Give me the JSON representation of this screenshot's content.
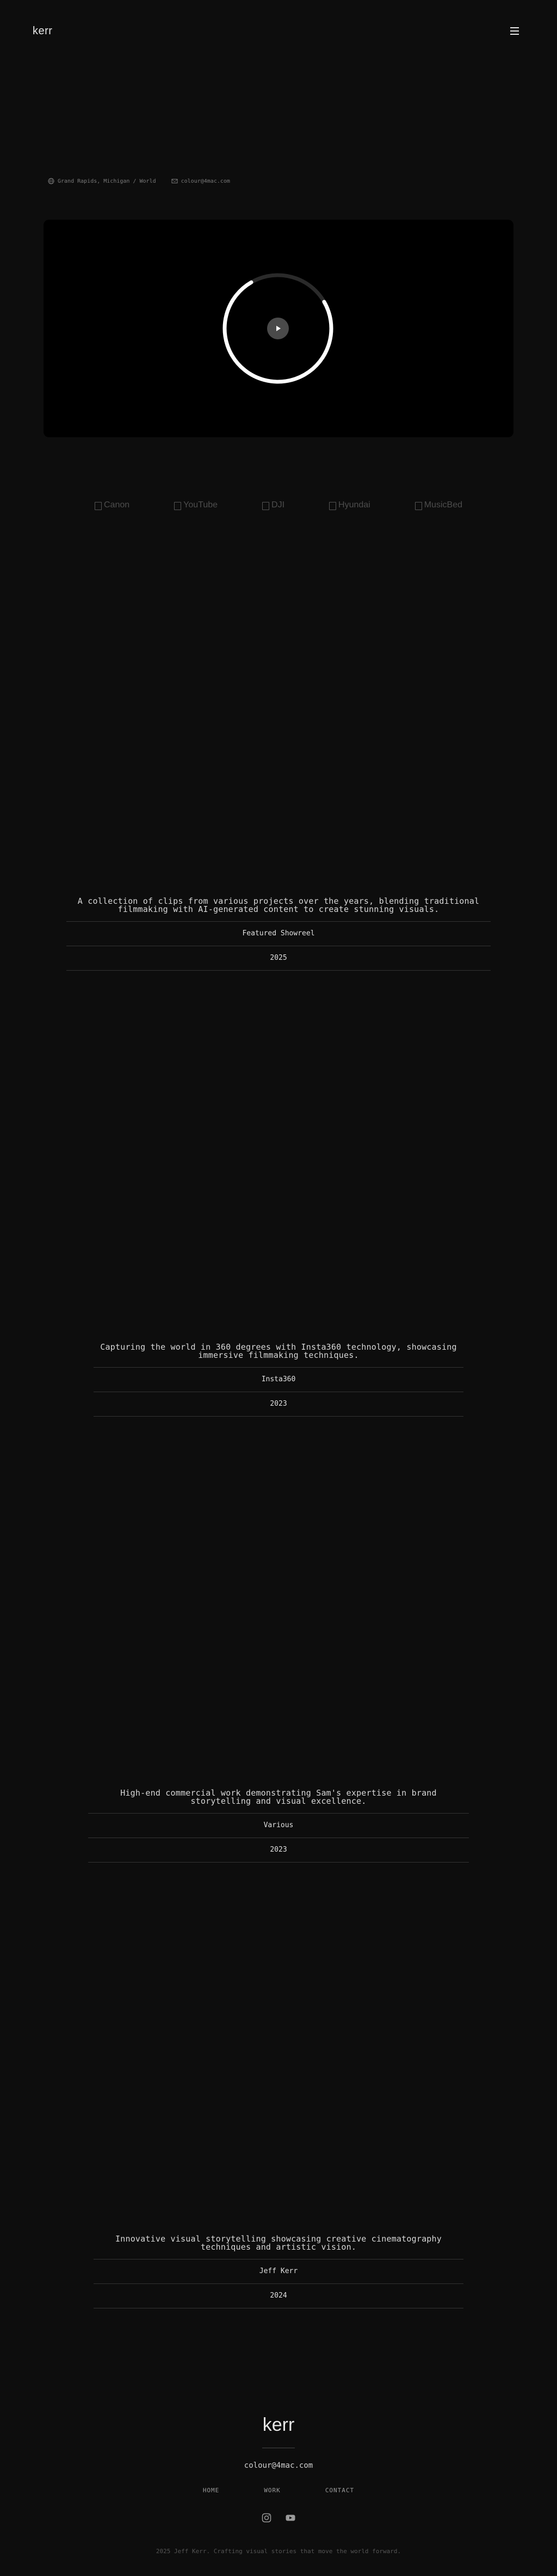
{
  "header": {
    "logo": "kerr",
    "menu_icon": "hamburger-icon"
  },
  "meta": {
    "location": "Grand Rapids, Michigan / World",
    "email": "colour@4mac.com",
    "location_icon": "globe-icon",
    "email_icon": "mail-icon"
  },
  "video": {
    "loader_icon": "loading-ring-icon",
    "play_icon": "play-icon"
  },
  "brands": [
    "Canon",
    "YouTube",
    "DJI",
    "Hyundai",
    "MusicBed"
  ],
  "projects": [
    {
      "description": "A collection of clips from various projects over the years, blending traditional filmmaking with AI-generated content to create stunning visuals.",
      "client": "Featured Showreel",
      "year": "2025"
    },
    {
      "description": "Capturing the world in 360 degrees with Insta360 technology, showcasing immersive filmmaking techniques.",
      "client": "Insta360",
      "year": "2023"
    },
    {
      "description": "High-end commercial work demonstrating Sam's expertise in brand storytelling and visual excellence.",
      "client": "Various",
      "year": "2023"
    },
    {
      "description": "Innovative visual storytelling showcasing creative cinematography techniques and artistic vision.",
      "client": "Jeff Kerr",
      "year": "2024"
    }
  ],
  "footer": {
    "logo": "kerr",
    "email": "colour@4mac.com",
    "nav": [
      "HOME",
      "WORK",
      "CONTACT"
    ],
    "social_icons": [
      "instagram-icon",
      "youtube-icon"
    ],
    "copyright": "2025 Jeff Kerr. Crafting visual stories that move the world forward."
  }
}
